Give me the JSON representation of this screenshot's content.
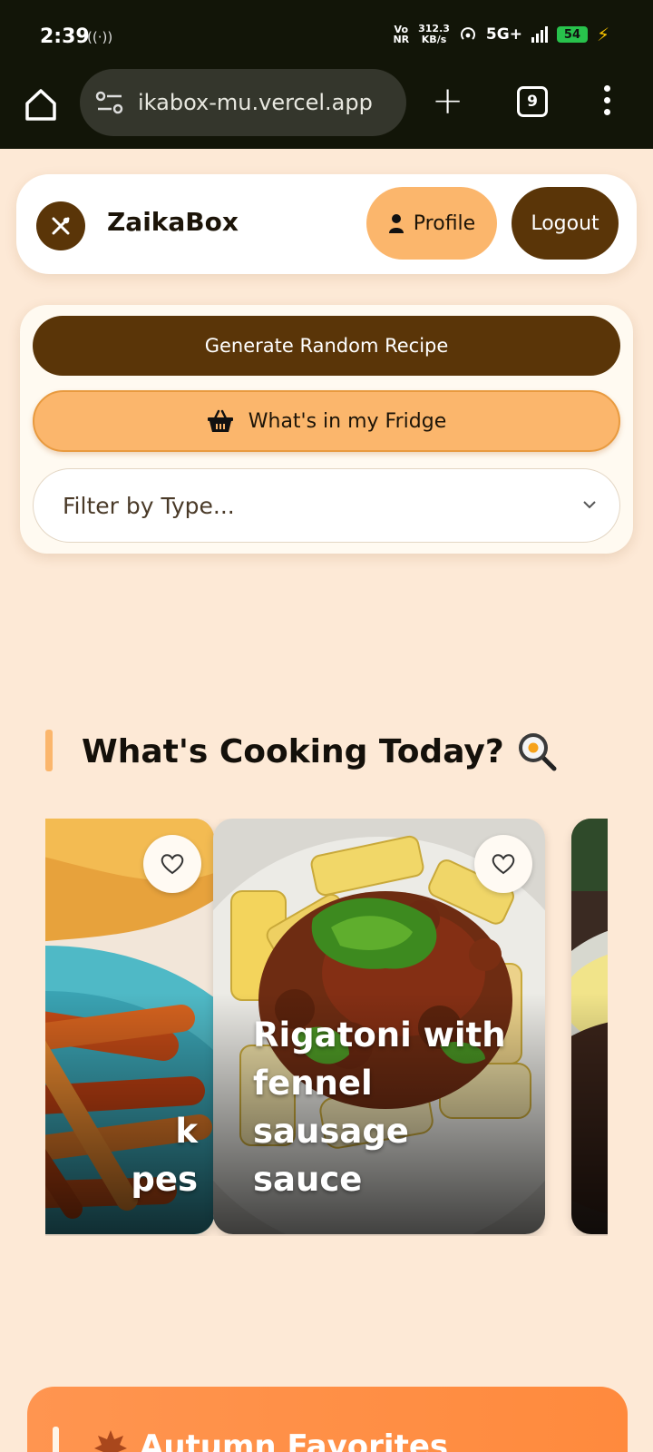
{
  "status_bar": {
    "time": "2:39",
    "hotspot_glyph": "((·))",
    "volte_line1": "Vo",
    "volte_line2": "NR",
    "speed_value": "312.3",
    "speed_unit": "KB/s",
    "network": "5G+",
    "battery": "54"
  },
  "browser": {
    "url": "ikabox-mu.vercel.app",
    "tab_count": "9"
  },
  "header": {
    "app_name": "ZaikaBox",
    "profile_label": "Profile",
    "logout_label": "Logout"
  },
  "actions": {
    "random_recipe_label": "Generate Random Recipe",
    "fridge_label": "What's in my Fridge",
    "filter_placeholder": "Filter by Type..."
  },
  "section": {
    "title": "What's Cooking Today?"
  },
  "recipes": [
    {
      "title": "k\npes",
      "position": "left-partial"
    },
    {
      "title": "Rigatoni with fennel sausage sauce",
      "position": "center"
    },
    {
      "title": "",
      "position": "right-partial"
    }
  ],
  "autumn": {
    "title": "Autumn Favorites"
  },
  "colors": {
    "page_bg": "#fde9d6",
    "brand_brown": "#5a3508",
    "accent_orange": "#fbb66c",
    "autumn_orange": "#ff8a3d"
  }
}
